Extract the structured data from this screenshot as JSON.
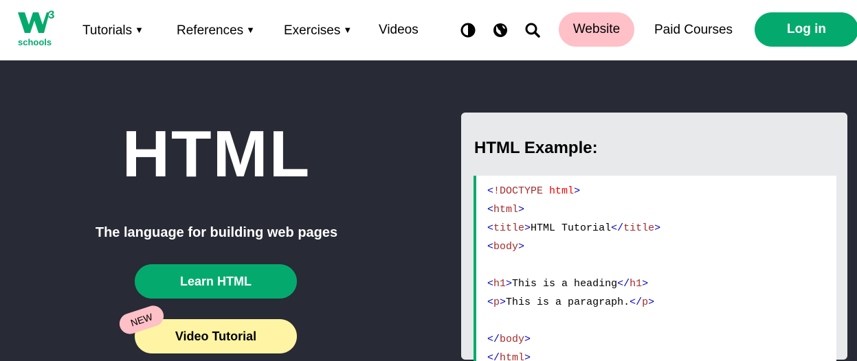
{
  "logo": {
    "superscript": "3",
    "wordmark": "schools",
    "icon": "w3-logo-icon"
  },
  "nav": {
    "links": [
      "Tutorials",
      "References",
      "Exercises",
      "Videos"
    ],
    "icons": [
      "contrast-icon",
      "globe-icon",
      "search-icon"
    ],
    "website_label": "Website",
    "paid_courses_label": "Paid Courses",
    "login_label": "Log in"
  },
  "hero": {
    "title": "HTML",
    "subtitle": "The language for building web pages",
    "learn_button": "Learn HTML",
    "video_button": "Video Tutorial",
    "new_badge": "NEW"
  },
  "example": {
    "title": "HTML Example:",
    "code_lines": [
      "<!DOCTYPE html>",
      "<html>",
      "<title>HTML Tutorial</title>",
      "<body>",
      "",
      "<h1>This is a heading</h1>",
      "<p>This is a paragraph.</p>",
      "",
      "</body>",
      "</html>"
    ]
  },
  "colors": {
    "brand_green": "#04AA6D",
    "hero_bg": "#282A35",
    "pink": "#FFC0C7",
    "yellow": "#FFF4A3"
  }
}
